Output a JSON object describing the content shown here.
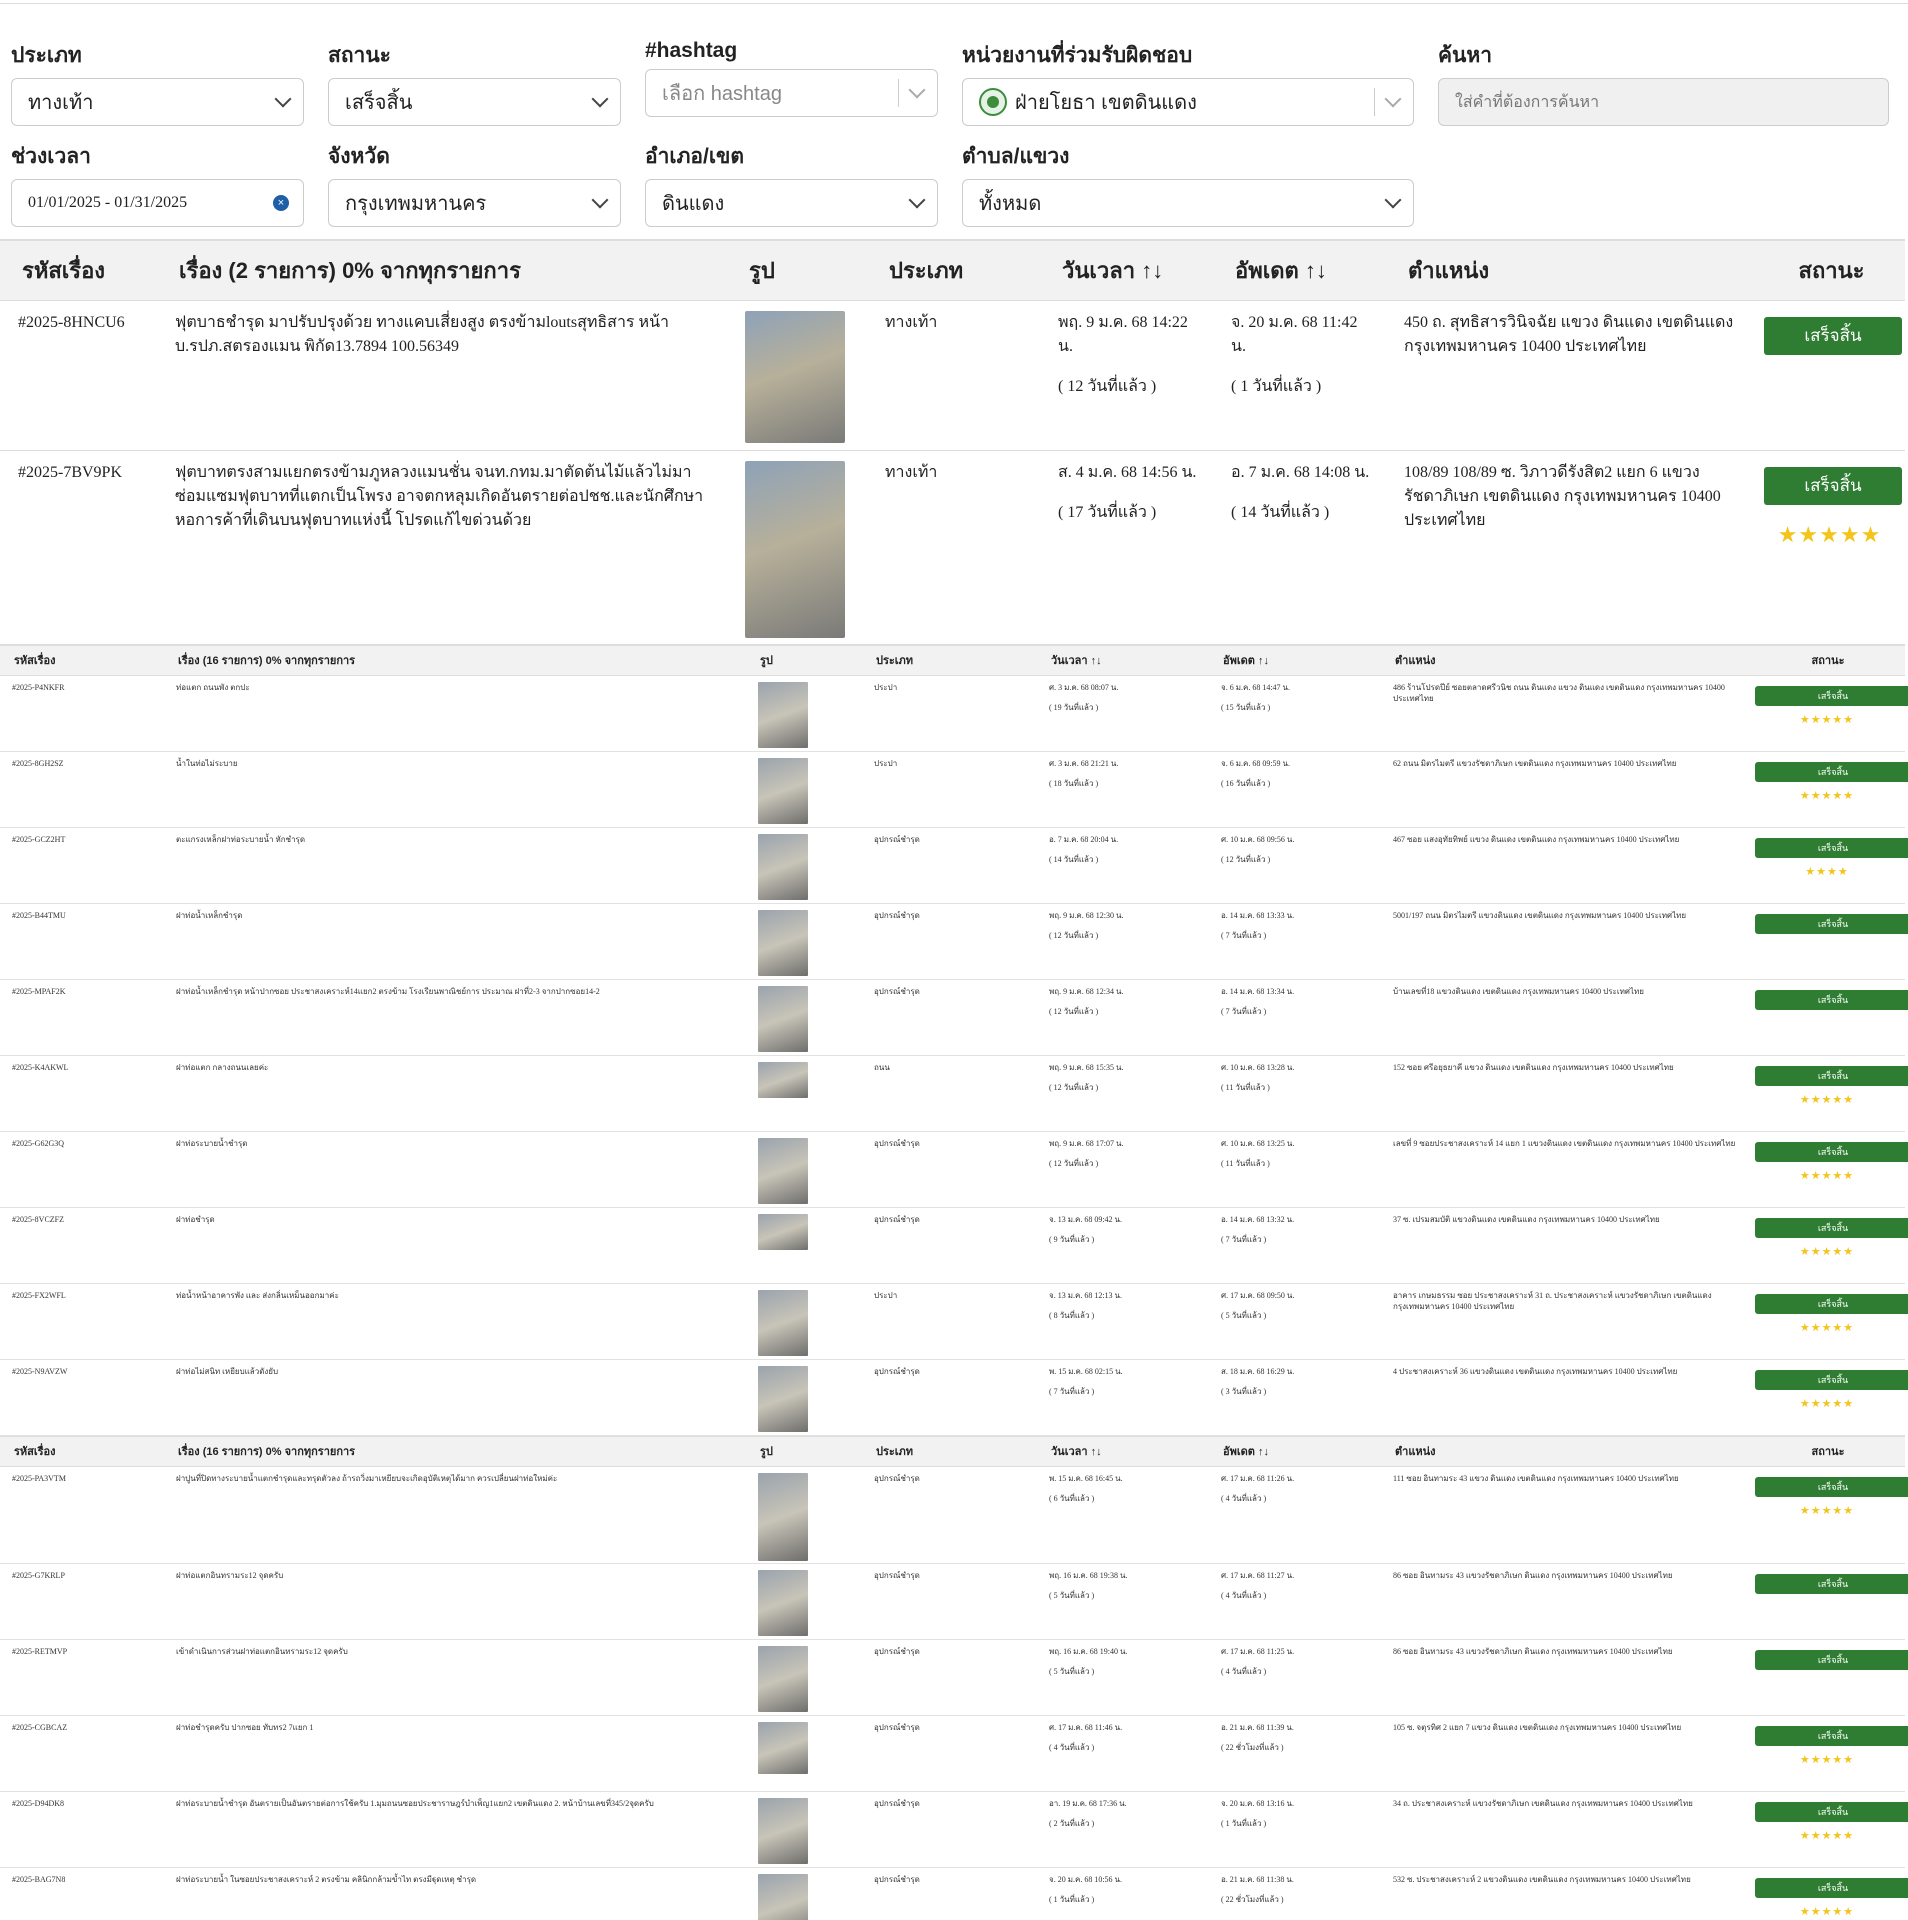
{
  "filters": {
    "type": {
      "label": "ประเภท",
      "value": "ทางเท้า"
    },
    "status": {
      "label": "สถานะ",
      "value": "เสร็จสิ้น"
    },
    "hashtag": {
      "label": "#hashtag",
      "placeholder": "เลือก hashtag"
    },
    "agency": {
      "label": "หน่วยงานที่ร่วมรับผิดชอบ",
      "value": "ฝ่ายโยธา เขตดินแดง"
    },
    "search": {
      "label": "ค้นหา",
      "placeholder": "ใส่คำที่ต้องการค้นหา"
    },
    "period": {
      "label": "ช่วงเวลา",
      "value": "01/01/2025 - 01/31/2025"
    },
    "province": {
      "label": "จังหวัด",
      "value": "กรุงเทพมหานคร"
    },
    "district": {
      "label": "อำเภอ/เขต",
      "value": "ดินแดง"
    },
    "subdistrict": {
      "label": "ตำบล/แขวง",
      "value": "ทั้งหมด"
    }
  },
  "table1": {
    "headers": {
      "id": "รหัสเรื่อง",
      "title": "เรื่อง (2 รายการ) 0% จากทุกรายการ",
      "photo": "รูป",
      "type": "ประเภท",
      "datetime": "วันเวลา ↑↓",
      "updated": "อัพเดต ↑↓",
      "location": "ตำแหน่ง",
      "status": "สถานะ"
    },
    "rows": [
      {
        "id": "#2025-8HNCU6",
        "title": "ฟุตบาธชำรุด มาปรับปรุงด้วย ทางแคบเสี่ยงสูง ตรงข้ามloutsสุทธิสาร หน้า บ.รปภ.สตรองแมน พิกัด13.7894 100.56349",
        "type": "ทางเท้า",
        "date": "พฤ. 9 ม.ค. 68 14:22 น.",
        "date_ago": "( 12 วันที่แล้ว )",
        "updated": "จ. 20 ม.ค. 68 11:42 น.",
        "updated_ago": "( 1 วันที่แล้ว )",
        "location": "450 ถ. สุทธิสารวินิจฉัย แขวง ดินแดง เขตดินแดง กรุงเทพมหานคร 10400 ประเทศไทย",
        "status": "เสร็จสิ้น",
        "stars": ""
      },
      {
        "id": "#2025-7BV9PK",
        "title": "ฟุตบาทตรงสามแยกตรงข้ามภูหลวงแมนชั่น จนท.กทม.มาตัดต้นไม้แล้วไม่มาซ่อมแซมฟุตบาทที่แตกเป็นโพรง อาจตกหลุมเกิดอันตรายต่อปชช.และนักศึกษาหอการค้าที่เดินบนฟุตบาทแห่งนี้ โปรดแก้ไขด่วนด้วย",
        "type": "ทางเท้า",
        "date": "ส. 4 ม.ค. 68 14:56 น.",
        "date_ago": "( 17 วันที่แล้ว )",
        "updated": "อ. 7 ม.ค. 68 14:08 น.",
        "updated_ago": "( 14 วันที่แล้ว )",
        "location": "108/89 108/89 ซ. วิภาวดีรังสิต2 แยก 6 แขวง รัชดาภิเษก เขตดินแดง กรุงเทพมหานคร 10400 ประเทศไทย",
        "status": "เสร็จสิ้น",
        "stars": "★★★★★"
      }
    ]
  },
  "table2": {
    "headers": {
      "id": "รหัสเรื่อง",
      "title": "เรื่อง (16 รายการ) 0% จากทุกรายการ",
      "photo": "รูป",
      "type": "ประเภท",
      "datetime": "วันเวลา ↑↓",
      "updated": "อัพเดต ↑↓",
      "location": "ตำแหน่ง",
      "status": "สถานะ"
    },
    "rows": [
      {
        "id": "#2025-P4NKFR",
        "title": "ท่อแตก ถนนพัง ตกปะ",
        "type": "ประปา",
        "date": "ศ. 3 ม.ค. 68 08:07 น.",
        "date_ago": "( 19 วันที่แล้ว )",
        "updated": "จ. 6 ม.ค. 68 14:47 น.",
        "updated_ago": "( 15 วันที่แล้ว )",
        "location": "486 ร้านโปรดปีย์ ซอยตลาดศรีวนิช ถนน ดินแดง แขวง ดินแดง เขตดินแดง กรุงเทพมหานคร 10400 ประเทศไทย",
        "status": "เสร็จสิ้น",
        "stars": "★★★★★"
      },
      {
        "id": "#2025-8GH2SZ",
        "title": "น้ำในท่อไม่ระบาย",
        "type": "ประปา",
        "date": "ศ. 3 ม.ค. 68 21:21 น.",
        "date_ago": "( 18 วันที่แล้ว )",
        "updated": "จ. 6 ม.ค. 68 09:59 น.",
        "updated_ago": "( 16 วันที่แล้ว )",
        "location": "62 ถนน มิตรไมตรี แขวงรัชดาภิเษก เขตดินแดง กรุงเทพมหานคร 10400 ประเทศไทย",
        "status": "เสร็จสิ้น",
        "stars": "★★★★★"
      },
      {
        "id": "#2025-GCZ2HT",
        "title": "ตะแกรงเหล็กฝาท่อระบายน้ำ หักชำรุด",
        "type": "อุปกรณ์ชำรุด",
        "date": "อ. 7 ม.ค. 68 20:04 น.",
        "date_ago": "( 14 วันที่แล้ว )",
        "updated": "ศ. 10 ม.ค. 68 09:56 น.",
        "updated_ago": "( 12 วันที่แล้ว )",
        "location": "467 ซอย แสงอุทัยทิพย์ แขวง ดินแดง เขตดินแดง กรุงเทพมหานคร 10400 ประเทศไทย",
        "status": "เสร็จสิ้น",
        "stars": "★★★★"
      },
      {
        "id": "#2025-B44TMU",
        "title": "ฝาท่อน้ำเหล็กชำรุด",
        "type": "อุปกรณ์ชำรุด",
        "date": "พฤ. 9 ม.ค. 68 12:30 น.",
        "date_ago": "( 12 วันที่แล้ว )",
        "updated": "อ. 14 ม.ค. 68 13:33 น.",
        "updated_ago": "( 7 วันที่แล้ว )",
        "location": "5001/197 ถนน มิตรไมตรี แขวงดินแดง เขตดินแดง กรุงเทพมหานคร 10400 ประเทศไทย",
        "status": "เสร็จสิ้น",
        "stars": ""
      },
      {
        "id": "#2025-MPAF2K",
        "title": "ฝาท่อน้ำเหล็กชำรุด หน้าปากซอย ประชาสงเคราะห์14แยก2 ตรงข้าม โรงเรียนพาณิชย์การ ประมาณ ฝาที่2-3 จากปากซอย14-2",
        "type": "อุปกรณ์ชำรุด",
        "date": "พฤ. 9 ม.ค. 68 12:34 น.",
        "date_ago": "( 12 วันที่แล้ว )",
        "updated": "อ. 14 ม.ค. 68 13:34 น.",
        "updated_ago": "( 7 วันที่แล้ว )",
        "location": "บ้านเลขที่18 แขวงดินแดง เขตดินแดง กรุงเทพมหานคร 10400 ประเทศไทย",
        "status": "เสร็จสิ้น",
        "stars": ""
      },
      {
        "id": "#2025-K4AKWL",
        "title": "ฝาท่อแตก กลางถนนเลยค่ะ",
        "type": "ถนน",
        "date": "พฤ. 9 ม.ค. 68 15:35 น.",
        "date_ago": "( 12 วันที่แล้ว )",
        "updated": "ศ. 10 ม.ค. 68 13:28 น.",
        "updated_ago": "( 11 วันที่แล้ว )",
        "location": "152 ซอย ศรีอยุธยาคี แขวง ดินแดง เขตดินแดง กรุงเทพมหานคร 10400 ประเทศไทย",
        "status": "เสร็จสิ้น",
        "stars": "★★★★★"
      },
      {
        "id": "#2025-G62G3Q",
        "title": "ฝาท่อระบายน้ำชำรุด",
        "type": "อุปกรณ์ชำรุด",
        "date": "พฤ. 9 ม.ค. 68 17:07 น.",
        "date_ago": "( 12 วันที่แล้ว )",
        "updated": "ศ. 10 ม.ค. 68 13:25 น.",
        "updated_ago": "( 11 วันที่แล้ว )",
        "location": "เลขที่ 9 ซอยประชาสงเคราะห์ 14 แยก 1 แขวงดินแดง เขตดินแดง กรุงเทพมหานคร 10400 ประเทศไทย",
        "status": "เสร็จสิ้น",
        "stars": "★★★★★"
      },
      {
        "id": "#2025-8VCZFZ",
        "title": "ฝาท่อชำรุด",
        "type": "อุปกรณ์ชำรุด",
        "date": "จ. 13 ม.ค. 68 09:42 น.",
        "date_ago": "( 9 วันที่แล้ว )",
        "updated": "อ. 14 ม.ค. 68 13:32 น.",
        "updated_ago": "( 7 วันที่แล้ว )",
        "location": "37 ซ. เปรมสมบัติ แขวงดินแดง เขตดินแดง กรุงเทพมหานคร 10400 ประเทศไทย",
        "status": "เสร็จสิ้น",
        "stars": "★★★★★"
      },
      {
        "id": "#2025-FX2WFL",
        "title": "ท่อน้ำหน้าอาคารพัง และ ส่งกลิ่นเหม็นออกมาค่ะ",
        "type": "ประปา",
        "date": "จ. 13 ม.ค. 68 12:13 น.",
        "date_ago": "( 8 วันที่แล้ว )",
        "updated": "ศ. 17 ม.ค. 68 09:50 น.",
        "updated_ago": "( 5 วันที่แล้ว )",
        "location": "อาคาร เกษมธรรม ซอย ประชาสงเคราะห์ 31 ถ. ประชาสงเคราะห์ แขวงรัชดาภิเษก เขตดินแดง กรุงเทพมหานคร 10400 ประเทศไทย",
        "status": "เสร็จสิ้น",
        "stars": "★★★★★"
      },
      {
        "id": "#2025-N9AVZW",
        "title": "ฝาท่อไม่สนิท เหยียบแล้วดังยับ",
        "type": "อุปกรณ์ชำรุด",
        "date": "พ. 15 ม.ค. 68 02:15 น.",
        "date_ago": "( 7 วันที่แล้ว )",
        "updated": "ส. 18 ม.ค. 68 16:29 น.",
        "updated_ago": "( 3 วันที่แล้ว )",
        "location": "4 ประชาสงเคราะห์ 36 แขวงดินแดง เขตดินแดง กรุงเทพมหานคร 10400 ประเทศไทย",
        "status": "เสร็จสิ้น",
        "stars": "★★★★★"
      }
    ]
  },
  "table3": {
    "headers": {
      "id": "รหัสเรื่อง",
      "title": "เรื่อง (16 รายการ) 0% จากทุกรายการ",
      "photo": "รูป",
      "type": "ประเภท",
      "datetime": "วันเวลา ↑↓",
      "updated": "อัพเดต ↑↓",
      "location": "ตำแหน่ง",
      "status": "สถานะ"
    },
    "rows": [
      {
        "id": "#2025-PA3VTM",
        "title": "ฝาปูนที่ปิดทางระบายน้ำแตกชำรุดและทรุดตัวลง ถ้ารถวิ่งมาเหยียบจะเกิดอุบัติเหตุได้มาก ควรเปลี่ยนฝาท่อใหม่ค่ะ",
        "type": "อุปกรณ์ชำรุด",
        "date": "พ. 15 ม.ค. 68 16:45 น.",
        "date_ago": "( 6 วันที่แล้ว )",
        "updated": "ศ. 17 ม.ค. 68 11:26 น.",
        "updated_ago": "( 4 วันที่แล้ว )",
        "location": "111 ซอย อินทามระ 43 แขวง ดินแดง เขตดินแดง กรุงเทพมหานคร 10400 ประเทศไทย",
        "status": "เสร็จสิ้น",
        "stars": "★★★★★"
      },
      {
        "id": "#2025-G7KRLP",
        "title": "ฝาท่อแตกอินทรามระ12 จุดครับ",
        "type": "อุปกรณ์ชำรุด",
        "date": "พฤ. 16 ม.ค. 68 19:38 น.",
        "date_ago": "( 5 วันที่แล้ว )",
        "updated": "ศ. 17 ม.ค. 68 11:27 น.",
        "updated_ago": "( 4 วันที่แล้ว )",
        "location": "86 ซอย อินทามระ 43 แขวงรัชดาภิเษก ดินแดง กรุงเทพมหานคร 10400 ประเทศไทย",
        "status": "เสร็จสิ้น",
        "stars": ""
      },
      {
        "id": "#2025-RETMVP",
        "title": "เข้าดำเนินการส่วนฝาท่อแตกอินทรามระ12 จุดครับ",
        "type": "อุปกรณ์ชำรุด",
        "date": "พฤ. 16 ม.ค. 68 19:40 น.",
        "date_ago": "( 5 วันที่แล้ว )",
        "updated": "ศ. 17 ม.ค. 68 11:25 น.",
        "updated_ago": "( 4 วันที่แล้ว )",
        "location": "86 ซอย อินทามระ 43 แขวงรัชดาภิเษก ดินแดง กรุงเทพมหานคร 10400 ประเทศไทย",
        "status": "เสร็จสิ้น",
        "stars": ""
      },
      {
        "id": "#2025-CGBCAZ",
        "title": "ฝาท่อชำรุดครับ ปากซอย ทับทร2 7แยก 1",
        "type": "อุปกรณ์ชำรุด",
        "date": "ศ. 17 ม.ค. 68 11:46 น.",
        "date_ago": "( 4 วันที่แล้ว )",
        "updated": "อ. 21 ม.ค. 68 11:39 น.",
        "updated_ago": "( 22 ชั่วโมงที่แล้ว )",
        "location": "105 ซ. จตุรทิศ 2 แยก 7 แขวง ดินแดง เขตดินแดง กรุงเทพมหานคร 10400 ประเทศไทย",
        "status": "เสร็จสิ้น",
        "stars": "★★★★★"
      },
      {
        "id": "#2025-D94DK8",
        "title": "ฝาท่อระบายน้ำชำรุด อันตรายเป็นอันตรายต่อการใช้ครับ 1.มุมถนนซอยประชาราษฎร์บำเพ็ญ1แยก2 เขตดินแดง 2. หน้าบ้านเลขที่345/2จุดครับ",
        "type": "อุปกรณ์ชำรุด",
        "date": "อา. 19 ม.ค. 68 17:36 น.",
        "date_ago": "( 2 วันที่แล้ว )",
        "updated": "จ. 20 ม.ค. 68 13:16 น.",
        "updated_ago": "( 1 วันที่แล้ว )",
        "location": "34 ถ. ประชาสงเคราะห์ แขวงรัชดาภิเษก เขตดินแดง กรุงเทพมหานคร 10400 ประเทศไทย",
        "status": "เสร็จสิ้น",
        "stars": "★★★★★"
      },
      {
        "id": "#2025-BAG7N8",
        "title": "ฝาท่อระบายน้ำ ในซอยประชาสงเคราะห์ 2 ตรงข้าม คลินิกกล้ามข้ำไท ตรงมีฐุดเหตุ ชำรุด",
        "type": "อุปกรณ์ชำรุด",
        "date": "จ. 20 ม.ค. 68 10:56 น.",
        "date_ago": "( 1 วันที่แล้ว )",
        "updated": "อ. 21 ม.ค. 68 11:38 น.",
        "updated_ago": "( 22 ชั่วโมงที่แล้ว )",
        "location": "532 ซ. ประชาสงเคราะห์ 2 แขวงดินแดง เขตดินแดง กรุงเทพมหานคร 10400 ประเทศไทย",
        "status": "เสร็จสิ้น",
        "stars": "★★★★★"
      }
    ]
  }
}
